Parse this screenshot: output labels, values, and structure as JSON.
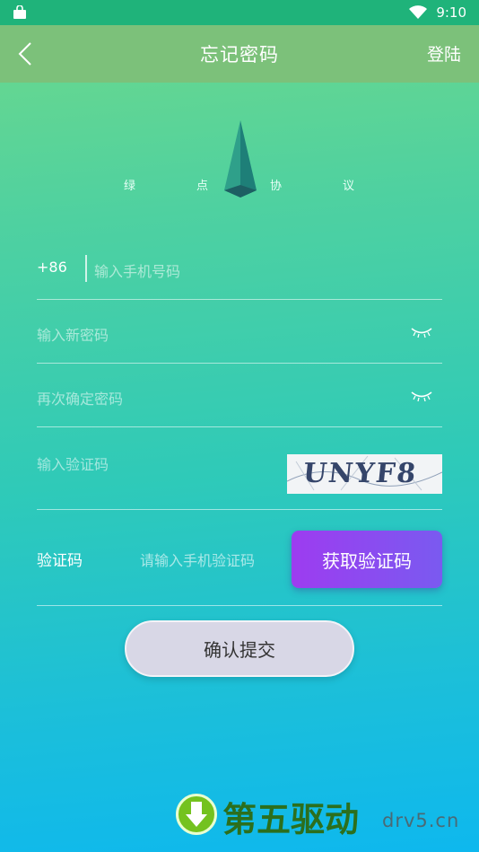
{
  "status_bar": {
    "time": "9:10"
  },
  "app_bar": {
    "title": "忘记密码",
    "right_action": "登陆",
    "back_icon": "chevron-left-icon"
  },
  "logo": {
    "letters": [
      "绿",
      "点",
      "协",
      "议"
    ]
  },
  "form": {
    "phone": {
      "prefix": "+86",
      "placeholder": "输入手机号码"
    },
    "new_password": {
      "placeholder": "输入新密码",
      "icon": "eye-closed-icon"
    },
    "confirm_password": {
      "placeholder": "再次确定密码",
      "icon": "eye-closed-icon"
    },
    "captcha": {
      "placeholder": "输入验证码",
      "image_text": "UNYF8"
    },
    "sms_code": {
      "label": "验证码",
      "placeholder": "请输入手机验证码",
      "button": "获取验证码"
    },
    "submit": "确认提交"
  },
  "watermark": {
    "name": "第五驱动",
    "url": "drv5.cn"
  },
  "colors": {
    "status_bar": "#1fb37a",
    "app_bar": "#7cc17a",
    "button_purple": "#8a4af0",
    "submit_bg": "#d8d7e6"
  }
}
